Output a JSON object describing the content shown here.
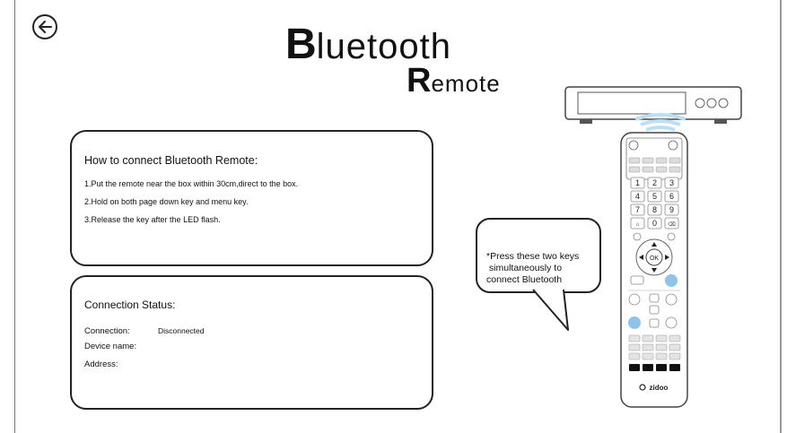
{
  "header": {
    "title_first": "B",
    "title_rest": "luetooth",
    "subtitle_first": "R",
    "subtitle_rest": "emote"
  },
  "back_button": {
    "icon": "arrow-left-icon"
  },
  "instructions": {
    "heading": "How to connect Bluetooth Remote:",
    "steps": [
      "1.Put the remote near the box within 30cm,direct to the box.",
      "2.Hold on both page down key and menu key.",
      "3.Release the key after the LED flash."
    ]
  },
  "status": {
    "heading": "Connection Status:",
    "connection_label": "Connection:",
    "connection_value": "Disconnected",
    "device_label": "Device name:",
    "device_value": "",
    "address_label": "Address:",
    "address_value": ""
  },
  "hint": {
    "lines": [
      "*Press these two keys",
      " simultaneously to",
      "connect Bluetooth"
    ]
  },
  "remote": {
    "brand": "zidoo",
    "ok_label": "OK",
    "keypad": [
      "1",
      "2",
      "3",
      "4",
      "5",
      "6",
      "7",
      "8",
      "9",
      "0"
    ],
    "highlight_color": "#8fc4ea"
  }
}
